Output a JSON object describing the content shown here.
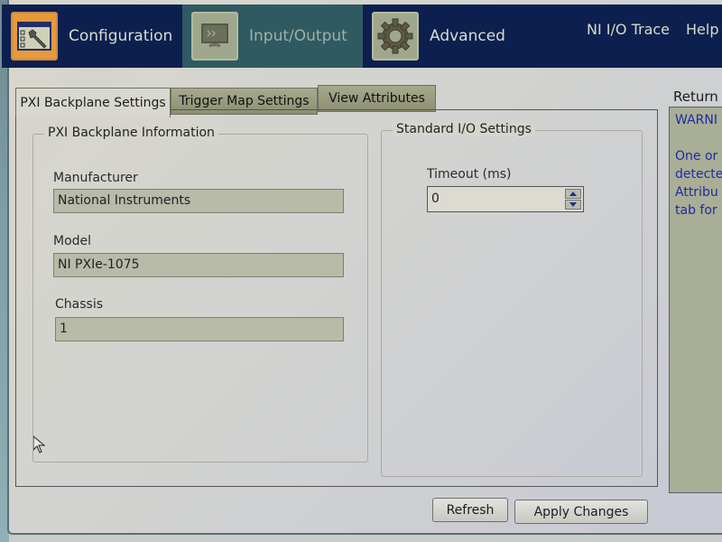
{
  "navbar": {
    "items": [
      {
        "label": "Configuration",
        "icon": "wrench-window-icon",
        "state": "selected"
      },
      {
        "label": "Input/Output",
        "icon": "monitor-icon",
        "state": "disabled"
      },
      {
        "label": "Advanced",
        "icon": "gear-icon",
        "state": "normal"
      }
    ],
    "links": [
      {
        "label": "NI I/O Trace"
      },
      {
        "label": "Help"
      }
    ]
  },
  "tabs": [
    {
      "label": "PXI Backplane Settings",
      "active": true
    },
    {
      "label": "Trigger Map Settings",
      "active": false
    },
    {
      "label": "View Attributes",
      "active": false
    }
  ],
  "backplane_info": {
    "title": "PXI Backplane Information",
    "fields": [
      {
        "label": "Manufacturer",
        "value": "National Instruments"
      },
      {
        "label": "Model",
        "value": "NI PXIe-1075"
      },
      {
        "label": "Chassis",
        "value": "1"
      }
    ]
  },
  "standard_io": {
    "title": "Standard I/O Settings",
    "timeout_label": "Timeout (ms)",
    "timeout_value": "0"
  },
  "buttons": {
    "refresh": "Refresh",
    "apply": "Apply Changes"
  },
  "return_panel": {
    "label": "Return",
    "lines": [
      "WARNI",
      "",
      "One or",
      "detecte",
      "Attribu",
      "tab for"
    ]
  }
}
